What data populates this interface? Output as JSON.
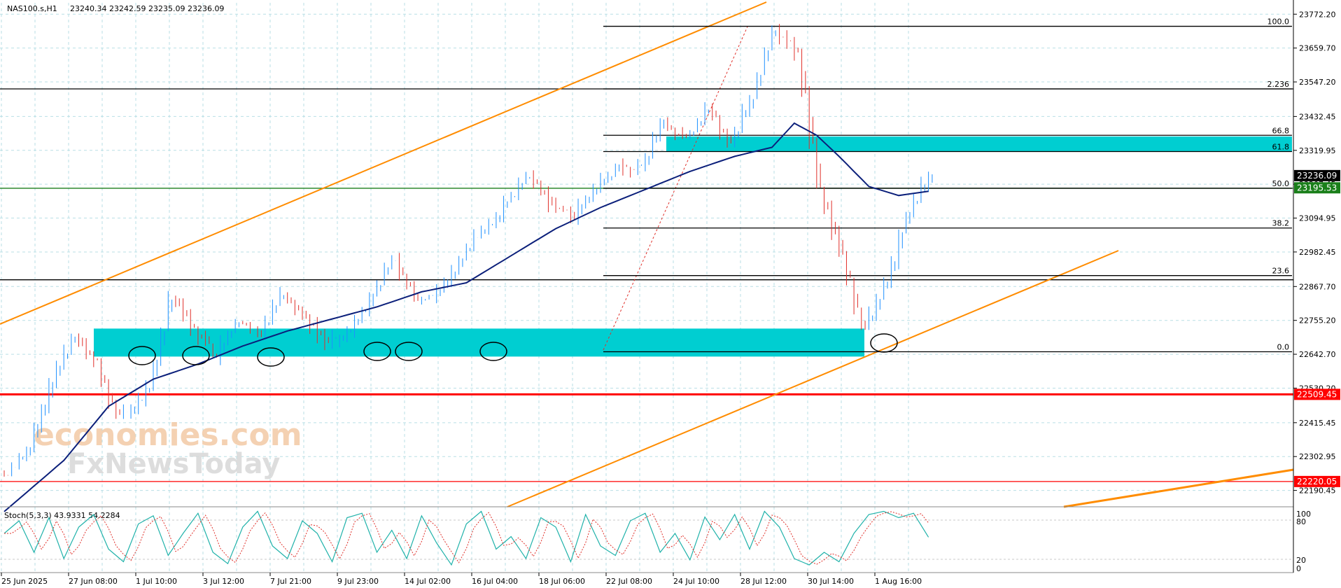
{
  "header": {
    "symbol": "NAS100.s,H1",
    "ohlc": "23240.34 23242.59 23235.09 23236.09"
  },
  "watermark": {
    "line1": "economies.com",
    "line2": "FxNewsToday"
  },
  "stoch": {
    "label": "Stoch(5,3,3) 43.9331 54.2284",
    "scale": [
      "100",
      "80",
      "20",
      "0"
    ]
  },
  "colors": {
    "bull": "#1e90ff",
    "bear": "#e0302a",
    "ma": "#0b1f7a",
    "zone": "#00ced1",
    "channel": "#ff8c00",
    "red_line": "#ff0000",
    "green_line": "#1a7f1a",
    "grid": "#b9dfe6"
  },
  "chart_data": {
    "type": "candlestick",
    "price_axis": {
      "range": [
        22150,
        23810
      ],
      "ticks": [
        "23772.20",
        "23659.70",
        "23547.20",
        "23432.45",
        "23319.95",
        "23207.45",
        "23094.95",
        "22982.45",
        "22867.70",
        "22755.20",
        "22642.70",
        "22530.20",
        "22415.45",
        "22302.95",
        "22190.45"
      ]
    },
    "time_axis": {
      "labels": [
        "25 Jun 2025",
        "27 Jun 08:00",
        "1 Jul 10:00",
        "3 Jul 12:00",
        "7 Jul 21:00",
        "9 Jul 23:00",
        "14 Jul 02:00",
        "16 Jul 04:00",
        "18 Jul 06:00",
        "22 Jul 08:00",
        "24 Jul 10:00",
        "28 Jul 12:00",
        "30 Jul 14:00",
        "1 Aug 16:00"
      ]
    },
    "price_tags": [
      {
        "value": "23236.09",
        "color": "#000000",
        "text_color": "#ffffff"
      },
      {
        "value": "23195.53",
        "color": "#1a7f1a",
        "text_color": "#ffffff"
      },
      {
        "value": "22509.45",
        "color": "#ff0000",
        "text_color": "#ffffff"
      },
      {
        "value": "22220.05",
        "color": "#ff0000",
        "text_color": "#ffffff"
      }
    ],
    "fibonacci": [
      {
        "label": "100.0",
        "price": 23732
      },
      {
        "label": "2.236",
        "price": 23524
      },
      {
        "label": "66.8",
        "price": 23370
      },
      {
        "label": "61.8",
        "price": 23316
      },
      {
        "label": "50.0",
        "price": 23194
      },
      {
        "label": "38.2",
        "price": 23062
      },
      {
        "label": "23.6",
        "price": 22904
      },
      {
        "label": "0.0",
        "price": 22651
      }
    ],
    "horizontal_lines": [
      {
        "price": 23524,
        "color": "#000000"
      },
      {
        "price": 22890,
        "color": "#000000"
      },
      {
        "price": 23194,
        "color": "#1a7f1a"
      },
      {
        "price": 22509.45,
        "color": "#ff0000"
      },
      {
        "price": 22220.05,
        "color": "#ff0000"
      }
    ],
    "zones": [
      {
        "price_top": 22728,
        "price_bottom": 22635,
        "color": "#00ced1"
      },
      {
        "price_top": 23366,
        "price_bottom": 23316,
        "color": "#00ced1"
      }
    ],
    "swing_points": [
      [
        0,
        22240
      ],
      [
        3,
        22330
      ],
      [
        6,
        22560
      ],
      [
        9,
        22700
      ],
      [
        12,
        22620
      ],
      [
        15,
        22430
      ],
      [
        19,
        22520
      ],
      [
        22,
        22830
      ],
      [
        25,
        22740
      ],
      [
        28,
        22640
      ],
      [
        31,
        22760
      ],
      [
        34,
        22700
      ],
      [
        37,
        22850
      ],
      [
        40,
        22760
      ],
      [
        43,
        22680
      ],
      [
        46,
        22720
      ],
      [
        49,
        22840
      ],
      [
        52,
        22960
      ],
      [
        55,
        22810
      ],
      [
        58,
        22860
      ],
      [
        61,
        22960
      ],
      [
        64,
        23050
      ],
      [
        67,
        23140
      ],
      [
        70,
        23230
      ],
      [
        73,
        23140
      ],
      [
        76,
        23100
      ],
      [
        79,
        23200
      ],
      [
        82,
        23270
      ],
      [
        85,
        23260
      ],
      [
        88,
        23420
      ],
      [
        91,
        23360
      ],
      [
        94,
        23460
      ],
      [
        97,
        23340
      ],
      [
        100,
        23500
      ],
      [
        103,
        23720
      ],
      [
        106,
        23650
      ],
      [
        109,
        23200
      ],
      [
        112,
        22980
      ],
      [
        115,
        22720
      ],
      [
        118,
        22890
      ],
      [
        121,
        23110
      ],
      [
        124,
        23236
      ]
    ],
    "ma_points": [
      [
        0,
        22120
      ],
      [
        8,
        22290
      ],
      [
        14,
        22470
      ],
      [
        20,
        22560
      ],
      [
        26,
        22610
      ],
      [
        32,
        22670
      ],
      [
        38,
        22720
      ],
      [
        44,
        22760
      ],
      [
        50,
        22800
      ],
      [
        56,
        22850
      ],
      [
        62,
        22880
      ],
      [
        68,
        22970
      ],
      [
        74,
        23060
      ],
      [
        80,
        23130
      ],
      [
        86,
        23190
      ],
      [
        92,
        23250
      ],
      [
        98,
        23300
      ],
      [
        103,
        23330
      ],
      [
        106,
        23410
      ],
      [
        109,
        23370
      ],
      [
        112,
        23300
      ],
      [
        116,
        23200
      ],
      [
        120,
        23170
      ],
      [
        124,
        23184
      ]
    ],
    "stoch_points": [
      [
        0,
        60
      ],
      [
        2,
        80
      ],
      [
        4,
        30
      ],
      [
        6,
        85
      ],
      [
        8,
        20
      ],
      [
        10,
        70
      ],
      [
        12,
        90
      ],
      [
        14,
        35
      ],
      [
        16,
        15
      ],
      [
        18,
        75
      ],
      [
        20,
        88
      ],
      [
        22,
        25
      ],
      [
        24,
        60
      ],
      [
        26,
        92
      ],
      [
        28,
        30
      ],
      [
        30,
        12
      ],
      [
        32,
        70
      ],
      [
        34,
        95
      ],
      [
        36,
        40
      ],
      [
        38,
        20
      ],
      [
        40,
        80
      ],
      [
        42,
        60
      ],
      [
        44,
        15
      ],
      [
        46,
        85
      ],
      [
        48,
        92
      ],
      [
        50,
        30
      ],
      [
        52,
        65
      ],
      [
        54,
        20
      ],
      [
        56,
        88
      ],
      [
        58,
        45
      ],
      [
        60,
        10
      ],
      [
        62,
        75
      ],
      [
        64,
        95
      ],
      [
        66,
        35
      ],
      [
        68,
        55
      ],
      [
        70,
        20
      ],
      [
        72,
        85
      ],
      [
        74,
        70
      ],
      [
        76,
        15
      ],
      [
        78,
        90
      ],
      [
        80,
        40
      ],
      [
        82,
        25
      ],
      [
        84,
        80
      ],
      [
        86,
        92
      ],
      [
        88,
        30
      ],
      [
        90,
        60
      ],
      [
        92,
        18
      ],
      [
        94,
        86
      ],
      [
        96,
        50
      ],
      [
        98,
        90
      ],
      [
        100,
        35
      ],
      [
        102,
        95
      ],
      [
        104,
        70
      ],
      [
        106,
        20
      ],
      [
        108,
        10
      ],
      [
        110,
        30
      ],
      [
        112,
        15
      ],
      [
        114,
        60
      ],
      [
        116,
        90
      ],
      [
        118,
        95
      ],
      [
        120,
        85
      ],
      [
        122,
        92
      ],
      [
        124,
        54
      ]
    ]
  }
}
